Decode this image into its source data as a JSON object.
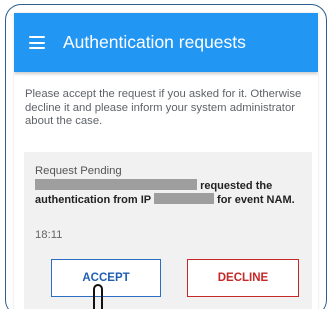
{
  "appbar": {
    "title": "Authentication requests",
    "menu_icon": "hamburger-menu-icon",
    "color": "#2196f3"
  },
  "intro": {
    "text": "Please accept the request if you asked for it. Otherwise decline it and please inform your system administrator about the case."
  },
  "request": {
    "title": "Request Pending",
    "text_part1": "requested the authentication from IP",
    "text_part2": "for event NAM.",
    "time": "18:11"
  },
  "buttons": {
    "accept": "ACCEPT",
    "decline": "DECLINE",
    "accept_color": "#1e5fb3",
    "decline_color": "#c62828"
  }
}
